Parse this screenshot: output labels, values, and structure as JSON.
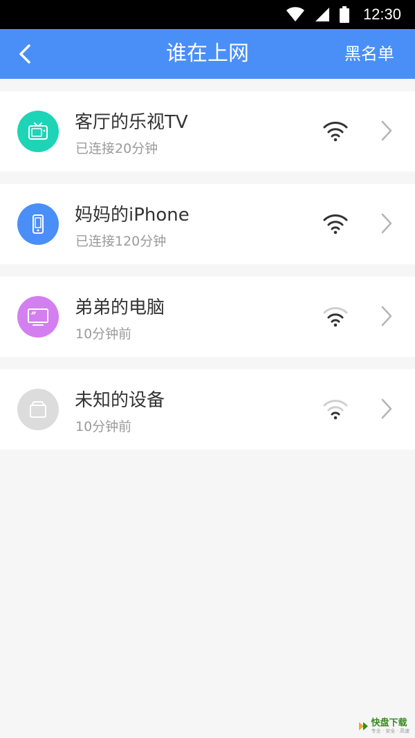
{
  "status_bar": {
    "time": "12:30"
  },
  "app_bar": {
    "title": "谁在上网",
    "action": "黑名单"
  },
  "devices": [
    {
      "name": "客厅的乐视TV",
      "status": "已连接20分钟",
      "icon": "tv-icon",
      "color": "#1ed4b6",
      "signal": "strong"
    },
    {
      "name": "妈妈的iPhone",
      "status": "已连接120分钟",
      "icon": "phone-icon",
      "color": "#4a8ef8",
      "signal": "strong"
    },
    {
      "name": "弟弟的电脑",
      "status": "10分钟前",
      "icon": "monitor-icon",
      "color": "#d47ff0",
      "signal": "medium"
    },
    {
      "name": "未知的设备",
      "status": "10分钟前",
      "icon": "box-icon",
      "color": "#dcdcdc",
      "signal": "weak"
    }
  ],
  "watermark": {
    "text": "快盘下载",
    "sub": "专业 · 安全 · 高速"
  }
}
